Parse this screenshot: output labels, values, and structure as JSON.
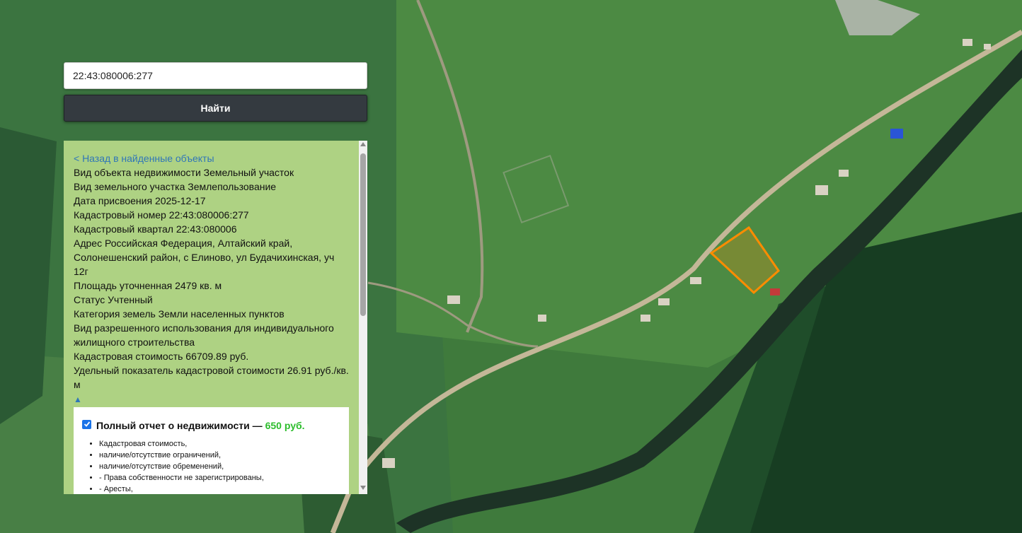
{
  "search": {
    "value": "22:43:080006:277",
    "button_label": "Найти"
  },
  "info": {
    "back_link": "< Назад в найденные объекты",
    "lines": [
      "Вид объекта недвижимости Земельный участок",
      "Вид земельного участка Землепользование",
      "Дата присвоения 2025-12-17",
      "Кадастровый номер 22:43:080006:277",
      "Кадастровый квартал 22:43:080006",
      "Адрес Российская Федерация, Алтайский край, Солонешенский район, с Елиново, ул Будачихинская, уч 12г",
      "Площадь уточненная 2479 кв. м",
      "Статус Учтенный",
      "Категория земель Земли населенных пунктов",
      "Вид разрешенного использования для индивидуального жилищного строительства",
      "Кадастровая стоимость 66709.89 руб.",
      "Удельный показатель кадастровой стоимости 26.91 руб./кв. м"
    ],
    "collapse_symbol": "▲"
  },
  "report": {
    "title": "Полный отчет о недвижимости —",
    "price": "650 руб.",
    "checked": true,
    "items": [
      "Кадастровая стоимость,",
      "наличие/отсутствие ограничений,",
      "наличие/отсутствие обременений,",
      "- Права собственности не зарегистрированы,",
      "- Аресты,"
    ]
  },
  "map": {
    "parcel_color": "#ff8c00"
  }
}
